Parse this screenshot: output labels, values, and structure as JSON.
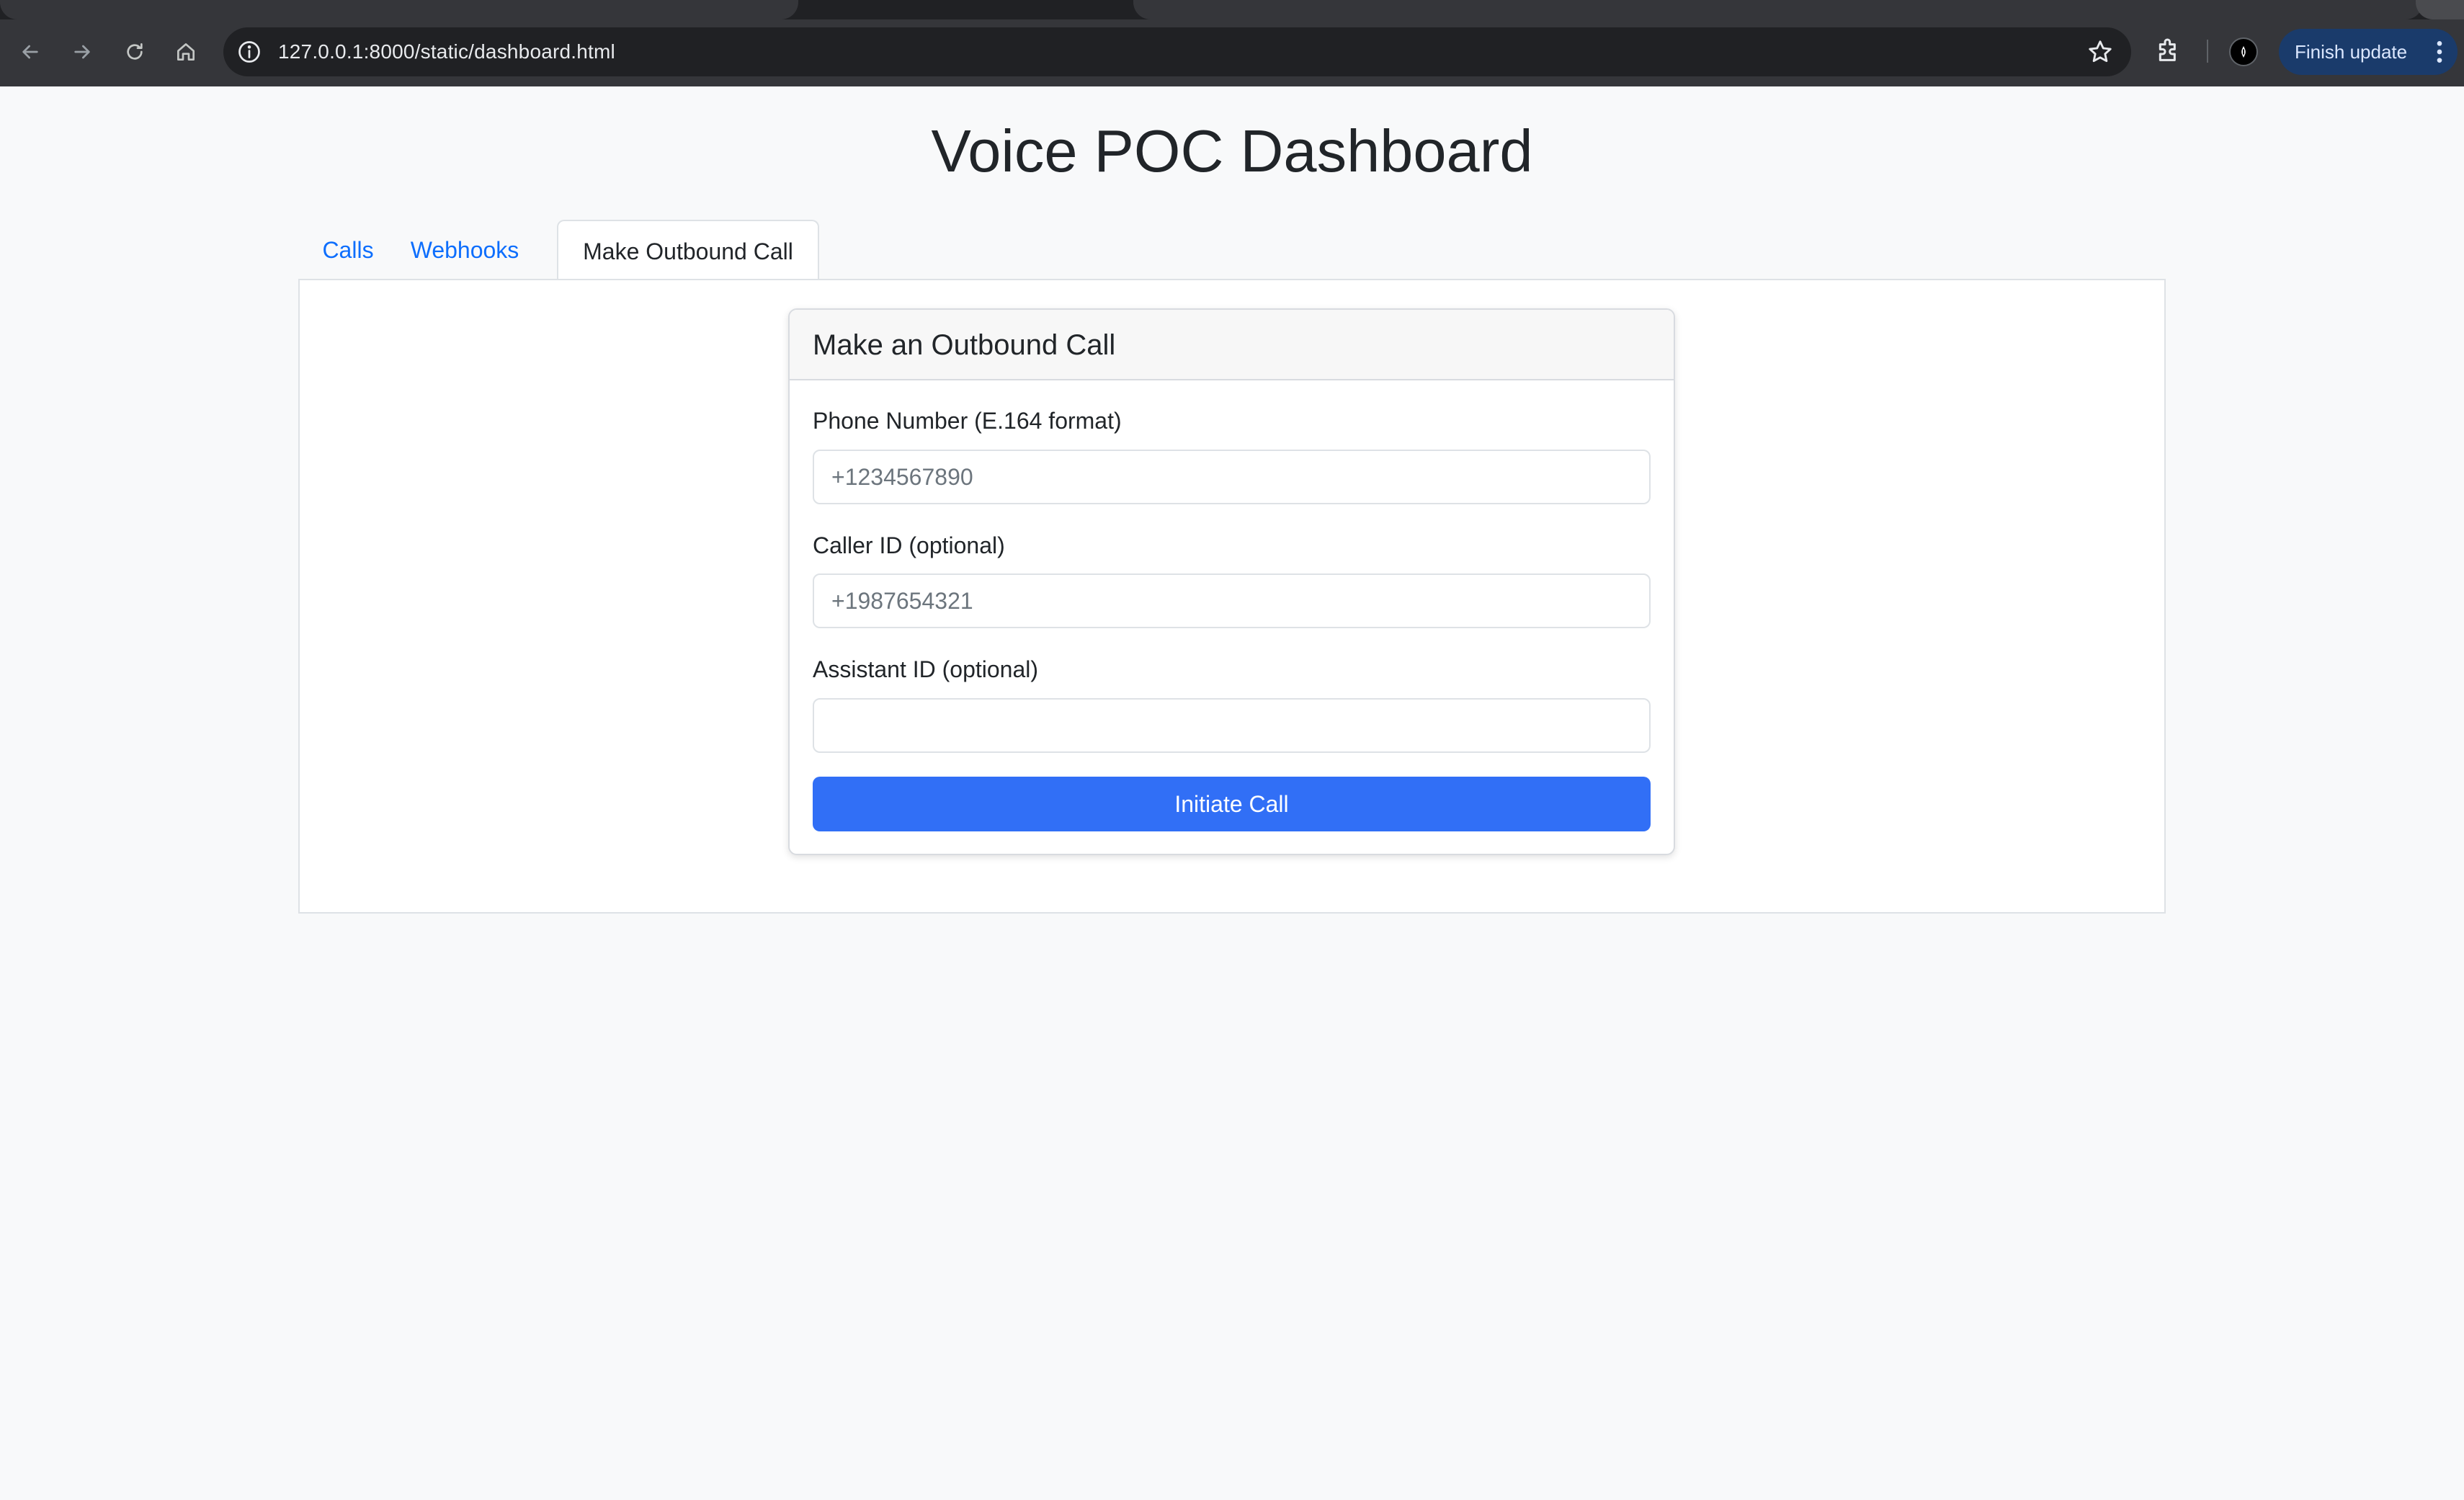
{
  "browser": {
    "url": "127.0.0.1:8000/static/dashboard.html",
    "finish_update_label": "Finish update"
  },
  "page": {
    "title": "Voice POC Dashboard"
  },
  "tabs": [
    {
      "label": "Calls",
      "active": false
    },
    {
      "label": "Webhooks",
      "active": false
    },
    {
      "label": "Make Outbound Call",
      "active": true
    }
  ],
  "outbound_form": {
    "card_title": "Make an Outbound Call",
    "phone_label": "Phone Number (E.164 format)",
    "phone_placeholder": "+1234567890",
    "phone_value": "",
    "caller_id_label": "Caller ID (optional)",
    "caller_id_placeholder": "+1987654321",
    "caller_id_value": "",
    "assistant_id_label": "Assistant ID (optional)",
    "assistant_id_placeholder": "",
    "assistant_id_value": "",
    "submit_label": "Initiate Call"
  },
  "colors": {
    "link": "#0d6efd",
    "primary_button": "#316ff6",
    "page_background": "#f8f9fa",
    "chrome_background": "#35363a"
  },
  "icons": {
    "back": "arrow-left-icon",
    "forward": "arrow-right-icon",
    "reload": "reload-icon",
    "home": "home-icon",
    "site_info": "info-icon",
    "bookmark": "star-icon",
    "extensions": "puzzle-icon",
    "profile": "profile-avatar-icon",
    "menu": "kebab-menu-icon"
  }
}
